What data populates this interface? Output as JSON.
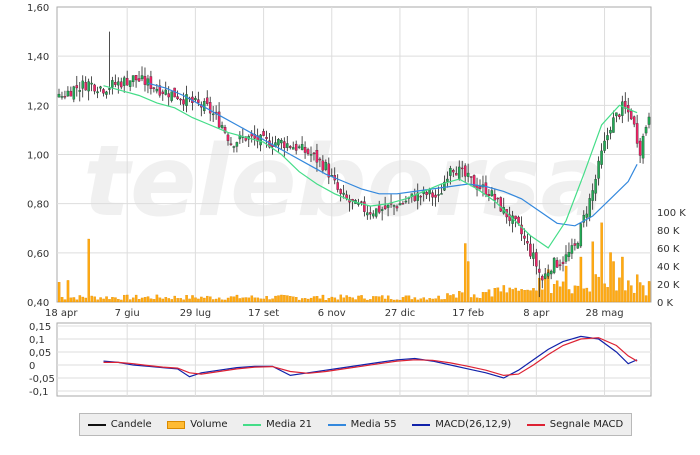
{
  "chart_data": {
    "type": "line",
    "x_ticks": [
      "18 apr",
      "7 giu",
      "29 lug",
      "17 set",
      "6 nov",
      "27 dic",
      "17 feb",
      "8 apr",
      "28 mag"
    ],
    "price_axis": {
      "ticks": [
        "0,40",
        "0,60",
        "0,80",
        "1,00",
        "1,20",
        "1,40",
        "1,60"
      ],
      "ylim": [
        0.4,
        1.6
      ]
    },
    "volume_axis": {
      "ticks": [
        "0 K",
        "20 K",
        "40 K",
        "60 K",
        "80 K",
        "100 K"
      ],
      "ylim": [
        0,
        100000
      ]
    },
    "macd_axis": {
      "ticks": [
        "0,15",
        "0,1",
        "0,05",
        "0",
        "-0,05",
        "-0,1"
      ],
      "ylim": [
        -0.1,
        0.15
      ]
    },
    "watermark": "teleborsa",
    "colors": {
      "candle_up": "#22aa55",
      "candle_down": "#ee2266",
      "candle_neutral": "#333333",
      "volume": "#ffaa11",
      "media21": "#44dd88",
      "media55": "#3388dd",
      "macd": "#1122aa",
      "signal": "#dd2233",
      "grid": "#d8d8d8"
    },
    "series": [
      {
        "name": "Media 21",
        "points": [
          [
            15,
            1.28
          ],
          [
            21,
            1.26
          ],
          [
            27,
            1.24
          ],
          [
            33,
            1.21
          ],
          [
            39,
            1.19
          ],
          [
            45,
            1.15
          ],
          [
            51,
            1.12
          ],
          [
            57,
            1.09
          ],
          [
            63,
            1.07
          ],
          [
            69,
            1.05
          ],
          [
            75,
            1.0
          ],
          [
            81,
            0.93
          ],
          [
            87,
            0.88
          ],
          [
            93,
            0.84
          ],
          [
            99,
            0.81
          ],
          [
            105,
            0.79
          ],
          [
            111,
            0.8
          ],
          [
            117,
            0.82
          ],
          [
            123,
            0.85
          ],
          [
            129,
            0.88
          ],
          [
            135,
            0.9
          ],
          [
            141,
            0.86
          ],
          [
            147,
            0.81
          ],
          [
            153,
            0.74
          ],
          [
            159,
            0.67
          ],
          [
            165,
            0.62
          ],
          [
            171,
            0.73
          ],
          [
            177,
            0.92
          ],
          [
            183,
            1.12
          ],
          [
            189,
            1.2
          ],
          [
            195,
            1.17
          ]
        ]
      },
      {
        "name": "Media 55",
        "points": [
          [
            30,
            1.29
          ],
          [
            36,
            1.27
          ],
          [
            42,
            1.24
          ],
          [
            48,
            1.2
          ],
          [
            54,
            1.16
          ],
          [
            60,
            1.12
          ],
          [
            66,
            1.08
          ],
          [
            72,
            1.04
          ],
          [
            78,
            1.0
          ],
          [
            84,
            0.96
          ],
          [
            90,
            0.92
          ],
          [
            96,
            0.89
          ],
          [
            102,
            0.86
          ],
          [
            108,
            0.84
          ],
          [
            114,
            0.84
          ],
          [
            120,
            0.85
          ],
          [
            126,
            0.86
          ],
          [
            132,
            0.87
          ],
          [
            138,
            0.88
          ],
          [
            144,
            0.87
          ],
          [
            150,
            0.85
          ],
          [
            156,
            0.82
          ],
          [
            162,
            0.77
          ],
          [
            168,
            0.72
          ],
          [
            174,
            0.71
          ],
          [
            180,
            0.75
          ],
          [
            186,
            0.82
          ],
          [
            192,
            0.89
          ],
          [
            195,
            0.96
          ]
        ]
      },
      {
        "name": "MACD(26,12,9)",
        "points": [
          [
            15,
            0.015
          ],
          [
            20,
            0.01
          ],
          [
            25,
            0.0
          ],
          [
            30,
            -0.005
          ],
          [
            35,
            -0.01
          ],
          [
            40,
            -0.015
          ],
          [
            44,
            -0.045
          ],
          [
            48,
            -0.03
          ],
          [
            54,
            -0.02
          ],
          [
            60,
            -0.01
          ],
          [
            66,
            -0.005
          ],
          [
            72,
            -0.005
          ],
          [
            78,
            -0.04
          ],
          [
            84,
            -0.03
          ],
          [
            90,
            -0.02
          ],
          [
            96,
            -0.01
          ],
          [
            102,
            0.0
          ],
          [
            108,
            0.01
          ],
          [
            114,
            0.02
          ],
          [
            120,
            0.025
          ],
          [
            126,
            0.015
          ],
          [
            132,
            0.0
          ],
          [
            138,
            -0.015
          ],
          [
            144,
            -0.03
          ],
          [
            150,
            -0.05
          ],
          [
            155,
            -0.02
          ],
          [
            160,
            0.02
          ],
          [
            165,
            0.06
          ],
          [
            170,
            0.09
          ],
          [
            176,
            0.11
          ],
          [
            182,
            0.1
          ],
          [
            188,
            0.05
          ],
          [
            192,
            0.005
          ],
          [
            195,
            0.02
          ]
        ]
      },
      {
        "name": "Segnale MACD",
        "points": [
          [
            15,
            0.01
          ],
          [
            20,
            0.01
          ],
          [
            25,
            0.005
          ],
          [
            30,
            -0.002
          ],
          [
            35,
            -0.008
          ],
          [
            40,
            -0.012
          ],
          [
            44,
            -0.03
          ],
          [
            48,
            -0.035
          ],
          [
            54,
            -0.025
          ],
          [
            60,
            -0.015
          ],
          [
            66,
            -0.008
          ],
          [
            72,
            -0.006
          ],
          [
            78,
            -0.025
          ],
          [
            84,
            -0.032
          ],
          [
            90,
            -0.025
          ],
          [
            96,
            -0.015
          ],
          [
            102,
            -0.005
          ],
          [
            108,
            0.005
          ],
          [
            114,
            0.015
          ],
          [
            120,
            0.02
          ],
          [
            126,
            0.018
          ],
          [
            132,
            0.008
          ],
          [
            138,
            -0.005
          ],
          [
            144,
            -0.02
          ],
          [
            150,
            -0.04
          ],
          [
            155,
            -0.035
          ],
          [
            160,
            0.0
          ],
          [
            165,
            0.04
          ],
          [
            170,
            0.075
          ],
          [
            176,
            0.1
          ],
          [
            182,
            0.105
          ],
          [
            188,
            0.075
          ],
          [
            192,
            0.035
          ],
          [
            195,
            0.015
          ]
        ]
      }
    ],
    "legend": [
      {
        "label": "Candele",
        "kind": "line",
        "color": "#111111"
      },
      {
        "label": "Volume",
        "kind": "bar",
        "color": "#ffbb33"
      },
      {
        "label": "Media 21",
        "kind": "line",
        "color": "#44dd88"
      },
      {
        "label": "Media 55",
        "kind": "line",
        "color": "#3388dd"
      },
      {
        "label": "MACD(26,12,9)",
        "kind": "line",
        "color": "#1122aa"
      },
      {
        "label": "Segnale MACD",
        "kind": "line",
        "color": "#dd2233"
      }
    ]
  }
}
